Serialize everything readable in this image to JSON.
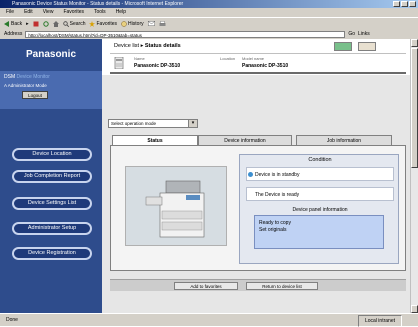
{
  "window": {
    "title": "Panasonic Device Status Monitor - Status details - Microsoft Internet Explorer"
  },
  "menubar": {
    "items": [
      "File",
      "Edit",
      "View",
      "Favorites",
      "Tools",
      "Help"
    ]
  },
  "toolbar": {
    "back": "Back",
    "forward": "▸",
    "search": "Search",
    "favorites": "Favorites",
    "history": "History"
  },
  "addressbar": {
    "label": "Address",
    "url": "http://localhost/DSM/status.html?id=DP-3510&tab=status",
    "go": "Go",
    "links": "Links"
  },
  "statusbar": {
    "left": "Done",
    "zone": "Local intranet"
  },
  "sidebar": {
    "logo": "Panasonic",
    "sub_title_1": "DSM",
    "sub_title_2": "Device Monitor",
    "sub_text": "A Administrator Mode",
    "logout": "Logout",
    "nav": [
      {
        "label": "Device Location"
      },
      {
        "label": "Job Completion Report"
      },
      {
        "label": "Device Settings List"
      },
      {
        "label": "Administrator Setup"
      },
      {
        "label": "Device Registration"
      }
    ]
  },
  "header": {
    "crumb_prefix": "Device list ▸",
    "crumb_title": "Status details",
    "name_label": "Name",
    "name_value": "Panasonic DP-3510",
    "location_label": "Location",
    "model_label": "Model name",
    "model_value": "Panasonic DP-3510"
  },
  "select": {
    "value": "Select operation mode"
  },
  "tabs": [
    {
      "label": "Status"
    },
    {
      "label": "Device information"
    },
    {
      "label": "Job information"
    }
  ],
  "condition": {
    "title": "Condition",
    "row1": "Device is in standby",
    "row2": "The Device is ready",
    "panel_title": "Device panel information",
    "panel_line1": "Ready to copy",
    "panel_line2": "Set originals"
  },
  "bottom": {
    "btn1": "Add to favorites",
    "btn2": "Return to device list"
  },
  "colors": {
    "sidebar": "#2e4c8c",
    "nav_button": "#1f3a7a",
    "panel_info": "#bfd2f4"
  }
}
